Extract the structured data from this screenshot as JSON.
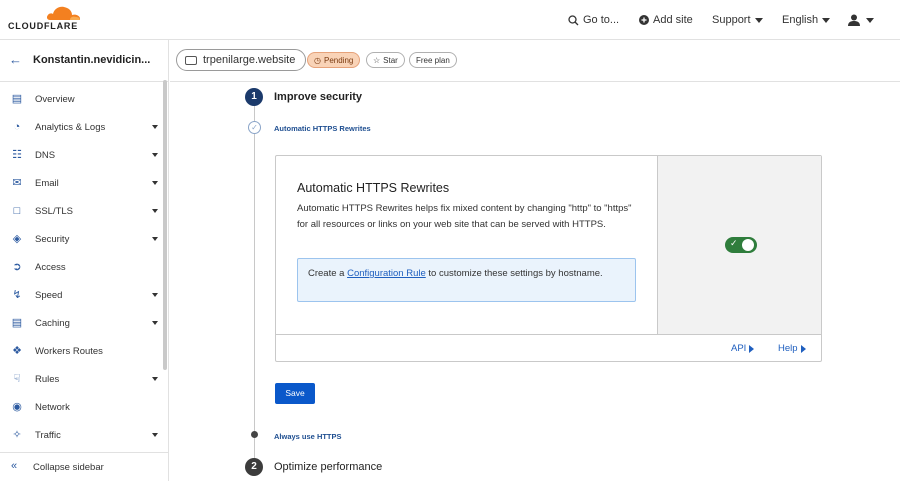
{
  "brand": {
    "name": "CLOUDFLARE",
    "accent": "#f38020"
  },
  "topnav": {
    "goto": "Go to...",
    "add_site": "Add site",
    "support": "Support",
    "language": "English"
  },
  "sidebar": {
    "account_name": "Konstantin.nevidicin...",
    "items": [
      {
        "label": "Overview",
        "icon": "clipboard-icon",
        "has_caret": false
      },
      {
        "label": "Analytics & Logs",
        "icon": "chart-icon",
        "has_caret": true
      },
      {
        "label": "DNS",
        "icon": "network-icon",
        "has_caret": true
      },
      {
        "label": "Email",
        "icon": "email-icon",
        "has_caret": true
      },
      {
        "label": "SSL/TLS",
        "icon": "lock-icon",
        "has_caret": true
      },
      {
        "label": "Security",
        "icon": "shield-icon",
        "has_caret": true
      },
      {
        "label": "Access",
        "icon": "access-icon",
        "has_caret": false
      },
      {
        "label": "Speed",
        "icon": "bolt-icon",
        "has_caret": true
      },
      {
        "label": "Caching",
        "icon": "server-icon",
        "has_caret": true
      },
      {
        "label": "Workers Routes",
        "icon": "workers-icon",
        "has_caret": false
      },
      {
        "label": "Rules",
        "icon": "rules-icon",
        "has_caret": true
      },
      {
        "label": "Network",
        "icon": "pin-icon",
        "has_caret": false
      },
      {
        "label": "Traffic",
        "icon": "traffic-icon",
        "has_caret": true
      }
    ],
    "collapse_label": "Collapse sidebar"
  },
  "zone": {
    "domain": "trpenilarge.website",
    "status": "Pending",
    "star_label": "Star",
    "plan": "Free plan"
  },
  "steps": {
    "step1": {
      "number": "1",
      "title": "Improve security"
    },
    "substep_active": "Automatic HTTPS Rewrites",
    "substep_next": "Always use HTTPS",
    "step2": {
      "number": "2",
      "title": "Optimize performance"
    }
  },
  "card": {
    "title": "Automatic HTTPS Rewrites",
    "description": "Automatic HTTPS Rewrites helps fix mixed content by changing \"http\" to \"https\" for all resources or links on your web site that can be served with HTTPS.",
    "info_prefix": "Create a ",
    "info_link": "Configuration Rule",
    "info_suffix": " to customize these settings by hostname.",
    "toggle_on": true,
    "api_link": "API",
    "help_link": "Help"
  },
  "save_label": "Save",
  "colors": {
    "primary_blue": "#0a58ca",
    "toggle_green": "#2f7d3c",
    "pending_bg": "#f9d3b7",
    "step_active": "#1b3a6b",
    "step_inactive": "#3c3c3c"
  }
}
